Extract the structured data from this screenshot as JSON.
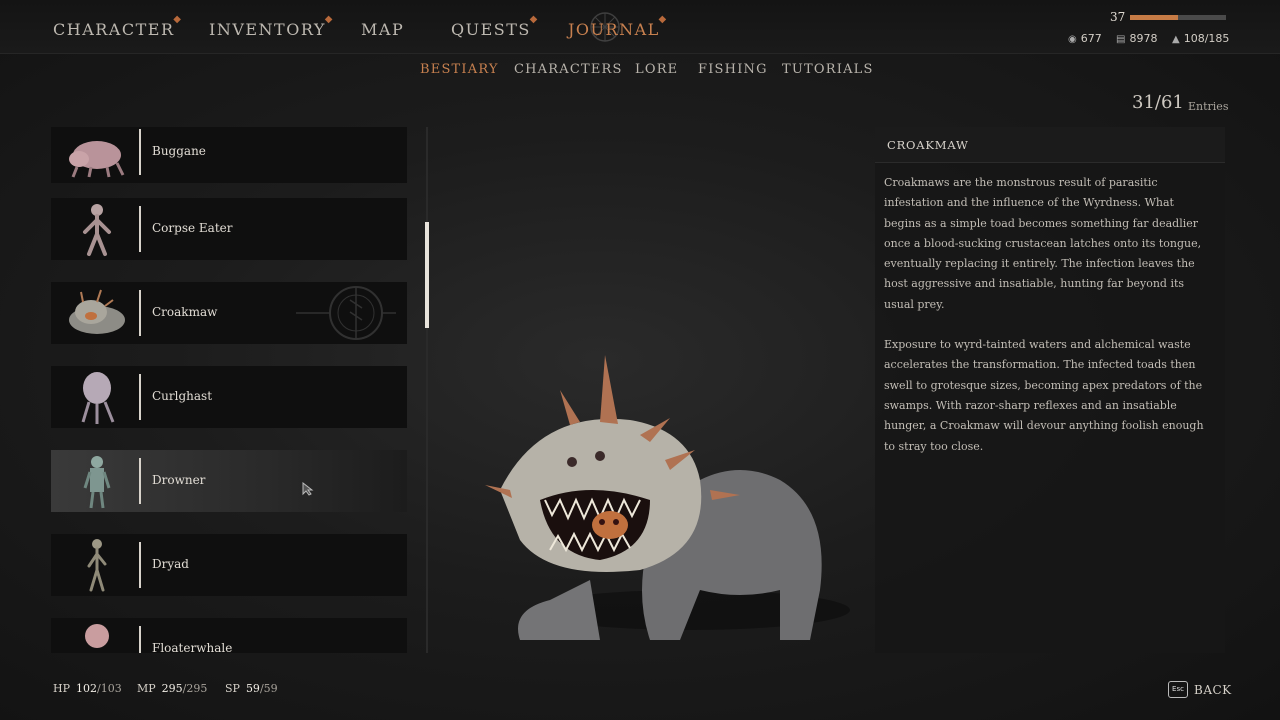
{
  "main_tabs": [
    {
      "label": "CHARACTER",
      "marker": true
    },
    {
      "label": "INVENTORY",
      "marker": true
    },
    {
      "label": "MAP",
      "marker": false
    },
    {
      "label": "QUESTS",
      "marker": true
    },
    {
      "label": "JOURNAL",
      "marker": true,
      "active": true
    }
  ],
  "player": {
    "level": "37",
    "xp_fraction": 0.5
  },
  "currencies": [
    {
      "icon": "crowns-icon",
      "value": "677"
    },
    {
      "icon": "ore-icon",
      "value": "8978"
    },
    {
      "icon": "weight-icon",
      "value": "108/185"
    }
  ],
  "sub_tabs": [
    {
      "label": "BESTIARY",
      "active": true
    },
    {
      "label": "CHARACTERS"
    },
    {
      "label": "LORE"
    },
    {
      "label": "FISHING"
    },
    {
      "label": "TUTORIALS"
    }
  ],
  "entries": {
    "count": "31/61",
    "label": "Entries"
  },
  "bestiary_list": [
    {
      "name": "Buggane",
      "icon": "buggane-thumbnail"
    },
    {
      "name": "Corpse Eater",
      "icon": "corpse-eater-thumbnail"
    },
    {
      "name": "Croakmaw",
      "icon": "croakmaw-thumbnail"
    },
    {
      "name": "Curlghast",
      "icon": "curlghast-thumbnail"
    },
    {
      "name": "Drowner",
      "icon": "drowner-thumbnail",
      "selected": true
    },
    {
      "name": "Dryad",
      "icon": "dryad-thumbnail"
    },
    {
      "name": "Floaterwhale",
      "icon": "next-creature-thumbnail"
    }
  ],
  "description": {
    "title": "CROAKMAW",
    "paragraphs": [
      "Croakmaws are the monstrous result of parasitic infestation and the influence of the Wyrdness. What begins as a simple toad becomes something far deadlier once a blood-sucking crustacean latches onto its tongue, eventually replacing it entirely. The infection leaves the host aggressive and insatiable, hunting far beyond its usual prey.",
      "Exposure to wyrd-tainted waters and alchemical waste accelerates the transformation. The infected toads then swell to grotesque sizes, becoming apex predators of the swamps. With razor-sharp reflexes and an insatiable hunger, a Croakmaw will devour anything foolish enough to stray too close."
    ]
  },
  "stats": [
    {
      "label": "HP",
      "current": "102",
      "max": "/103"
    },
    {
      "label": "MP",
      "current": "295",
      "max": "/295"
    },
    {
      "label": "SP",
      "current": "59",
      "max": "/59"
    }
  ],
  "back": {
    "key": "Esc",
    "label": "BACK"
  }
}
